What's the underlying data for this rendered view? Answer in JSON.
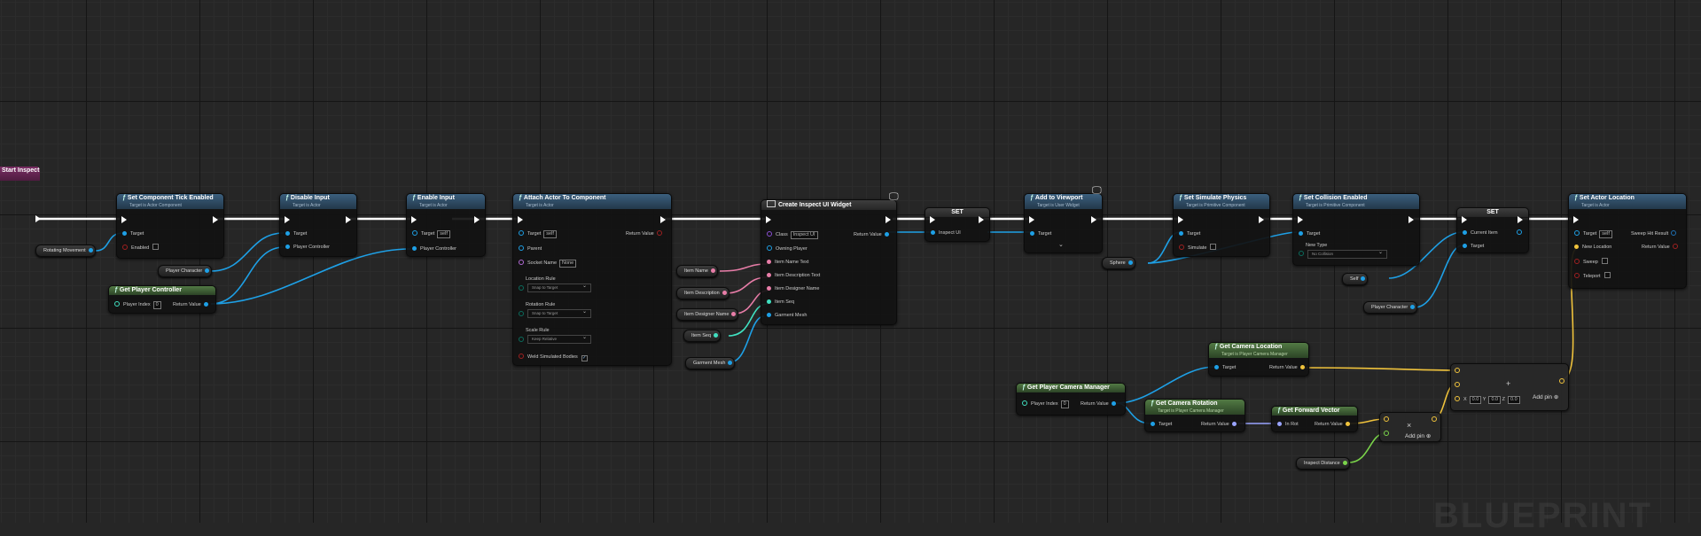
{
  "app": {
    "watermark": "BLUEPRINT"
  },
  "event_node": {
    "title": "Start Inspect"
  },
  "nodes": {
    "set_tick": {
      "title": "Set Component Tick Enabled",
      "subtitle": "Target is Actor Component",
      "pins": [
        "Target",
        "Enabled"
      ]
    },
    "disable_input": {
      "title": "Disable Input",
      "subtitle": "Target is Actor",
      "pins": [
        "Target",
        "Player Controller"
      ]
    },
    "enable_input": {
      "title": "Enable Input",
      "subtitle": "Target is Actor",
      "pins": [
        "Target",
        "Player Controller"
      ],
      "target_value": "self"
    },
    "attach_actor": {
      "title": "Attach Actor To Component",
      "subtitle": "Target is Actor",
      "target_value": "self",
      "socket_value": "None",
      "pins": [
        "Target",
        "Parent",
        "Socket Name",
        "Location Rule",
        "Rotation Rule",
        "Scale Rule",
        "Weld Simulated Bodies",
        "Return Value"
      ],
      "location_rule": "Snap to Target",
      "rotation_rule": "Snap to Target",
      "scale_rule": "Keep Relative"
    },
    "create_widget": {
      "title": "Create Inspect UI Widget",
      "pins": [
        "Class",
        "Owning Player",
        "Item Name Text",
        "Item Description Text",
        "Item Designer Name",
        "Item Seq",
        "Garment Mesh",
        "Return Value"
      ],
      "class_value": "Inspect UI"
    },
    "set_inspect": {
      "title": "SET",
      "pin": "Inspect UI"
    },
    "add_viewport": {
      "title": "Add to Viewport",
      "subtitle": "Target is User Widget",
      "pin": "Target"
    },
    "simulate_physics": {
      "title": "Set Simulate Physics",
      "subtitle": "Target is Primitive Component",
      "pins": [
        "Target",
        "Simulate"
      ]
    },
    "collision": {
      "title": "Set Collision Enabled",
      "subtitle": "Target is Primitive Component",
      "pins": [
        "Target",
        "New Type"
      ],
      "new_type": "No Collision"
    },
    "set_current": {
      "title": "SET",
      "pins": [
        "Current Item",
        "Target"
      ]
    },
    "actor_location": {
      "title": "Set Actor Location",
      "subtitle": "Target is Actor",
      "pins": [
        "Target",
        "New Location",
        "Sweep",
        "Teleport",
        "Sweep Hit Result",
        "Return Value"
      ],
      "target_value": "self"
    },
    "player_controller": {
      "title": "Get Player Controller",
      "pins": [
        "Player Index",
        "Return Value"
      ],
      "index": "0"
    },
    "cam_manager": {
      "title": "Get Player Camera Manager",
      "pins": [
        "Player Index",
        "Return Value"
      ],
      "index": "0"
    },
    "cam_location": {
      "title": "Get Camera Location",
      "subtitle": "Target is Player Camera Manager",
      "pins": [
        "Target",
        "Return Value"
      ]
    },
    "cam_rotation": {
      "title": "Get Camera Rotation",
      "subtitle": "Target is Player Camera Manager",
      "pins": [
        "Target",
        "Return Value"
      ]
    },
    "forward_vector": {
      "title": "Get Forward Vector",
      "pins": [
        "In Rot",
        "Return Value"
      ]
    },
    "multiply": {
      "symbol": "×",
      "add_pin": "Add pin"
    },
    "add": {
      "symbol": "+",
      "add_pin": "Add pin",
      "x": "0.0",
      "y": "0.0",
      "z": "0.0",
      "xl": "X",
      "yl": "Y",
      "zl": "Z"
    }
  },
  "variables": {
    "rotating_movement": "Rotating Movement",
    "player_character_1": "Player Character",
    "item_name": "Item Name",
    "item_description": "Item Description",
    "item_designer": "Item Designer Name",
    "item_seq": "Item Seq",
    "garment_mesh": "Garment Mesh",
    "sphere": "Sphere",
    "self": "Self",
    "player_character_2": "Player Character",
    "inspect_distance": "Inspect Distance"
  },
  "colors": {
    "exec": "#ffffff",
    "object": "#1ea0e6",
    "string": "#e87da8",
    "vector": "#f0c33c",
    "float": "#7ad34a",
    "rotator": "#9aa4ff",
    "int": "#40e0c0",
    "bool": "#a02020",
    "enum": "#0a6b5c"
  }
}
